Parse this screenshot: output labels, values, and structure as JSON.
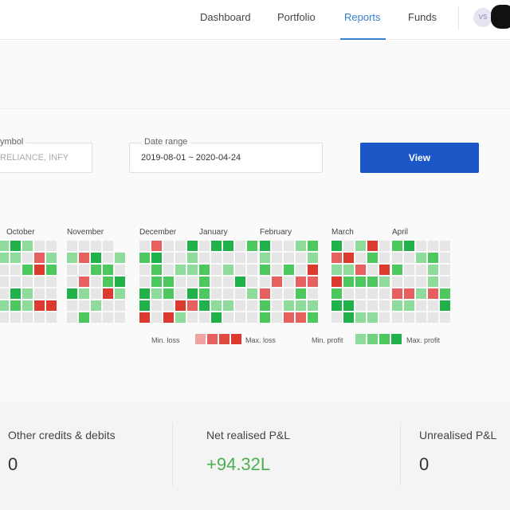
{
  "nav": {
    "links": [
      "Dashboard",
      "Portfolio",
      "Reports",
      "Funds"
    ],
    "active": "Reports",
    "avatar_initials": "VS"
  },
  "filters": {
    "symbol_label": "ymbol",
    "symbol_placeholder": "RELIANCE, INFY",
    "date_label": "Date range",
    "date_value": "2019-08-01 ~ 2020-04-24",
    "view_label": "View"
  },
  "heatmap": {
    "months": [
      "October",
      "November",
      "December",
      "January",
      "February",
      "March",
      "April"
    ],
    "legend": {
      "min_loss": "Min. loss",
      "max_loss": "Max. loss",
      "min_profit": "Min. profit",
      "max_profit": "Max. profit"
    },
    "colors": {
      "empty": "#e6e6e6",
      "profit_low": "#8fdb9c",
      "profit_mid": "#4cc85f",
      "profit_high": "#21b14a",
      "loss_low": "#f0a3a3",
      "loss_mid": "#e66060",
      "loss_high": "#dc3a2e"
    }
  },
  "stats": [
    {
      "label": "Other credits & debits",
      "value": "0",
      "tone": "neutral"
    },
    {
      "label": "Net realised P&L",
      "value": "+94.32L",
      "tone": "positive"
    },
    {
      "label": "Unrealised P&L",
      "value": "0",
      "tone": "neutral"
    }
  ]
}
